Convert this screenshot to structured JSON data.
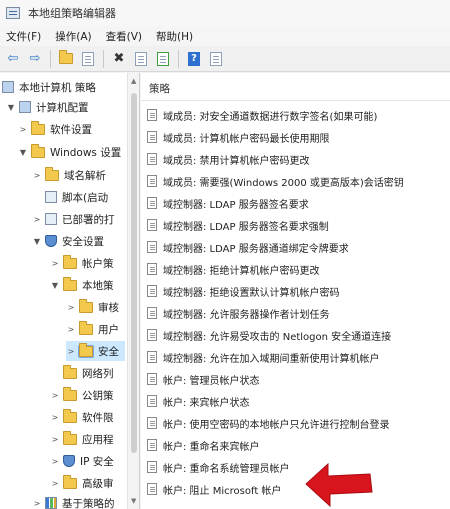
{
  "window": {
    "title": "本地组策略编辑器"
  },
  "menu": [
    "文件(F)",
    "操作(A)",
    "查看(V)",
    "帮助(H)"
  ],
  "toolbar": [
    {
      "icon": "back-arrow-icon",
      "glyph": "⇦"
    },
    {
      "icon": "forward-arrow-icon",
      "glyph": "⇨"
    },
    {
      "icon": "up-folder-icon",
      "glyph": ""
    },
    {
      "icon": "show-hide-tree-icon",
      "glyph": ""
    },
    {
      "icon": "delete-x-icon",
      "glyph": "✖"
    },
    {
      "icon": "properties-icon",
      "glyph": ""
    },
    {
      "icon": "export-list-icon",
      "glyph": ""
    },
    {
      "icon": "help-icon",
      "glyph": "?"
    },
    {
      "icon": "view-icon",
      "glyph": ""
    }
  ],
  "tree": [
    {
      "label": "本地计算机 策略",
      "icon": "computer-policy-icon",
      "expander": ""
    },
    {
      "label": "计算机配置",
      "icon": "computer-icon",
      "expander": "▼"
    },
    {
      "label": "软件设置",
      "icon": "folder-icon",
      "expander": ">"
    },
    {
      "label": "Windows 设置",
      "icon": "folder-icon",
      "expander": "▼"
    },
    {
      "label": "域名解析",
      "icon": "folder-icon",
      "expander": ">"
    },
    {
      "label": "脚本(启动",
      "icon": "script-icon",
      "expander": ""
    },
    {
      "label": "已部署的打",
      "icon": "printer-icon",
      "expander": ">"
    },
    {
      "label": "安全设置",
      "icon": "shield-icon",
      "expander": "▼"
    },
    {
      "label": "帐户策",
      "icon": "folder-icon",
      "expander": ">"
    },
    {
      "label": "本地策",
      "icon": "folder-icon",
      "expander": "▼"
    },
    {
      "label": "审核",
      "icon": "folder-icon",
      "expander": ">"
    },
    {
      "label": "用户",
      "icon": "folder-icon",
      "expander": ">"
    },
    {
      "label": "安全",
      "icon": "folder-icon",
      "expander": ">"
    },
    {
      "label": "网络列",
      "icon": "folder-icon",
      "expander": ""
    },
    {
      "label": "公钥策",
      "icon": "folder-icon",
      "expander": ">"
    },
    {
      "label": "软件限",
      "icon": "folder-icon",
      "expander": ">"
    },
    {
      "label": "应用程",
      "icon": "folder-icon",
      "expander": ">"
    },
    {
      "label": "IP 安全",
      "icon": "ip-security-icon",
      "expander": ">"
    },
    {
      "label": "高级审",
      "icon": "folder-icon",
      "expander": ">"
    },
    {
      "label": "基于策略的",
      "icon": "chart-icon",
      "expander": ">"
    }
  ],
  "policy_list": {
    "header": "策略",
    "items": [
      "域成员: 对安全通道数据进行数字签名(如果可能)",
      "域成员: 计算机帐户密码最长使用期限",
      "域成员: 禁用计算机帐户密码更改",
      "域成员: 需要强(Windows 2000 或更高版本)会话密钥",
      "域控制器: LDAP 服务器签名要求",
      "域控制器: LDAP 服务器签名要求强制",
      "域控制器: LDAP 服务器通道绑定令牌要求",
      "域控制器: 拒绝计算机帐户密码更改",
      "域控制器: 拒绝设置默认计算机帐户密码",
      "域控制器: 允许服务器操作者计划任务",
      "域控制器: 允许易受攻击的 Netlogon 安全通道连接",
      "域控制器: 允许在加入域期间重新使用计算机帐户",
      "帐户: 管理员帐户状态",
      "帐户: 来宾帐户状态",
      "帐户: 使用空密码的本地帐户只允许进行控制台登录",
      "帐户: 重命名来宾帐户",
      "帐户: 重命名系统管理员帐户",
      "帐户: 阻止 Microsoft 帐户"
    ]
  },
  "colors": {
    "annotation_arrow": "#d8141c",
    "selection": "#cce8ff"
  }
}
